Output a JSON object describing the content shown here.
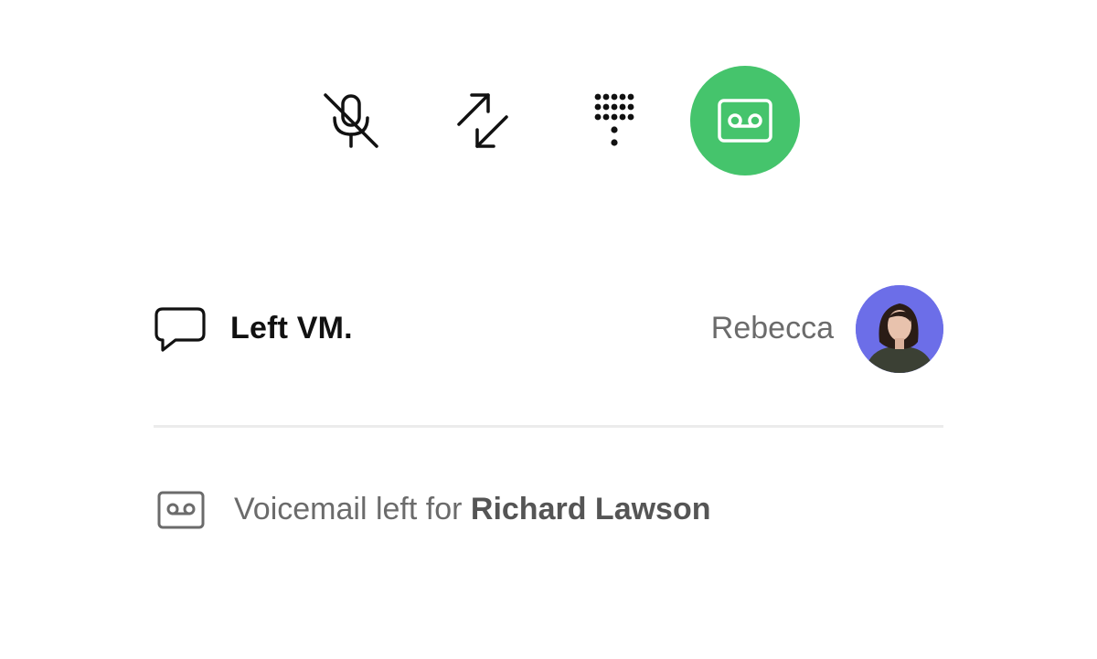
{
  "call_controls": {
    "mute": {
      "icon": "microphone-off-icon"
    },
    "transfer": {
      "icon": "transfer-arrows-icon"
    },
    "keypad": {
      "icon": "dialpad-icon"
    },
    "voicemail": {
      "icon": "voicemail-icon",
      "active_color": "#45c46c"
    }
  },
  "note": {
    "icon": "chat-bubble-icon",
    "text": "Left VM.",
    "author": "Rebecca",
    "avatar_bg": "#6c6ee8"
  },
  "event": {
    "icon": "voicemail-icon",
    "prefix": "Voicemail left for ",
    "contact": "Richard Lawson"
  }
}
